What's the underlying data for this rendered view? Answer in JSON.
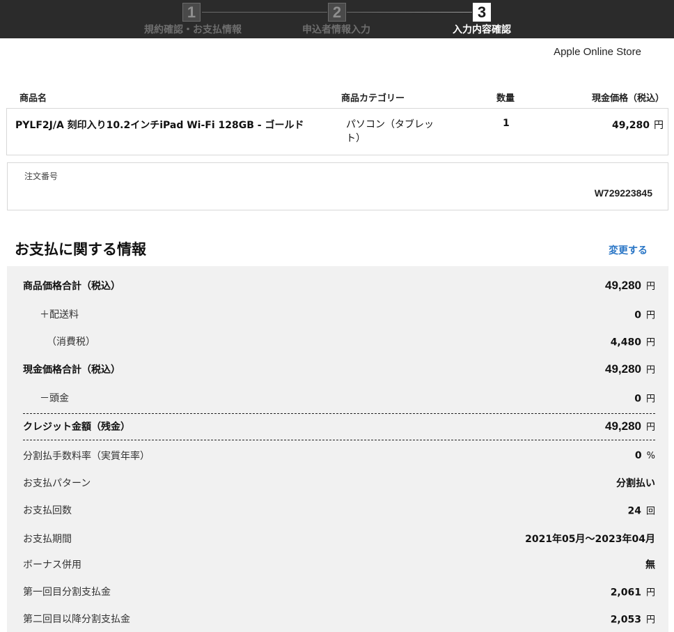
{
  "stepper": {
    "steps": [
      {
        "number": "1",
        "label": "規約確認・お支払情報",
        "active": false
      },
      {
        "number": "2",
        "label": "申込者情報入力",
        "active": false
      },
      {
        "number": "3",
        "label": "入力内容確認",
        "active": true
      }
    ]
  },
  "store_name": "Apple Online Store",
  "product_table": {
    "headers": {
      "name": "商品名",
      "category": "商品カテゴリー",
      "quantity": "数量",
      "price": "現金価格（税込）"
    },
    "row": {
      "name": "PYLF2J/A 刻印入り10.2インチiPad Wi-Fi 128GB - ゴールド",
      "category": "パソコン（タブレット）",
      "quantity": "1",
      "price": "49,280",
      "price_unit": "円"
    }
  },
  "order": {
    "label": "注文番号",
    "number": "W729223845"
  },
  "payment": {
    "title": "お支払に関する情報",
    "change_label": "変更する",
    "rows": [
      {
        "label": "商品価格合計（税込）",
        "value": "49,280",
        "unit": "円"
      },
      {
        "label": "＋配送料",
        "value": "0",
        "unit": "円"
      },
      {
        "label": "（消費税）",
        "value": "4,480",
        "unit": "円"
      },
      {
        "label": "現金価格合計（税込）",
        "value": "49,280",
        "unit": "円"
      },
      {
        "label": "－頭金",
        "value": "0",
        "unit": "円"
      },
      {
        "label": "クレジット金額（残金）",
        "value": "49,280",
        "unit": "円"
      },
      {
        "label": "分割払手数料率（実質年率）",
        "value": "0",
        "unit": "%"
      },
      {
        "label": "お支払パターン",
        "value": "分割払い",
        "unit": ""
      },
      {
        "label": "お支払回数",
        "value": "24",
        "unit": "回"
      },
      {
        "label": "お支払期間",
        "value": "2021年05月～2023年04月",
        "unit": ""
      },
      {
        "label": "ボーナス併用",
        "value": "無",
        "unit": ""
      },
      {
        "label": "第一回目分割支払金",
        "value": "2,061",
        "unit": "円"
      },
      {
        "label": "第二回目以降分割支払金",
        "value": "2,053",
        "unit": "円"
      }
    ]
  }
}
